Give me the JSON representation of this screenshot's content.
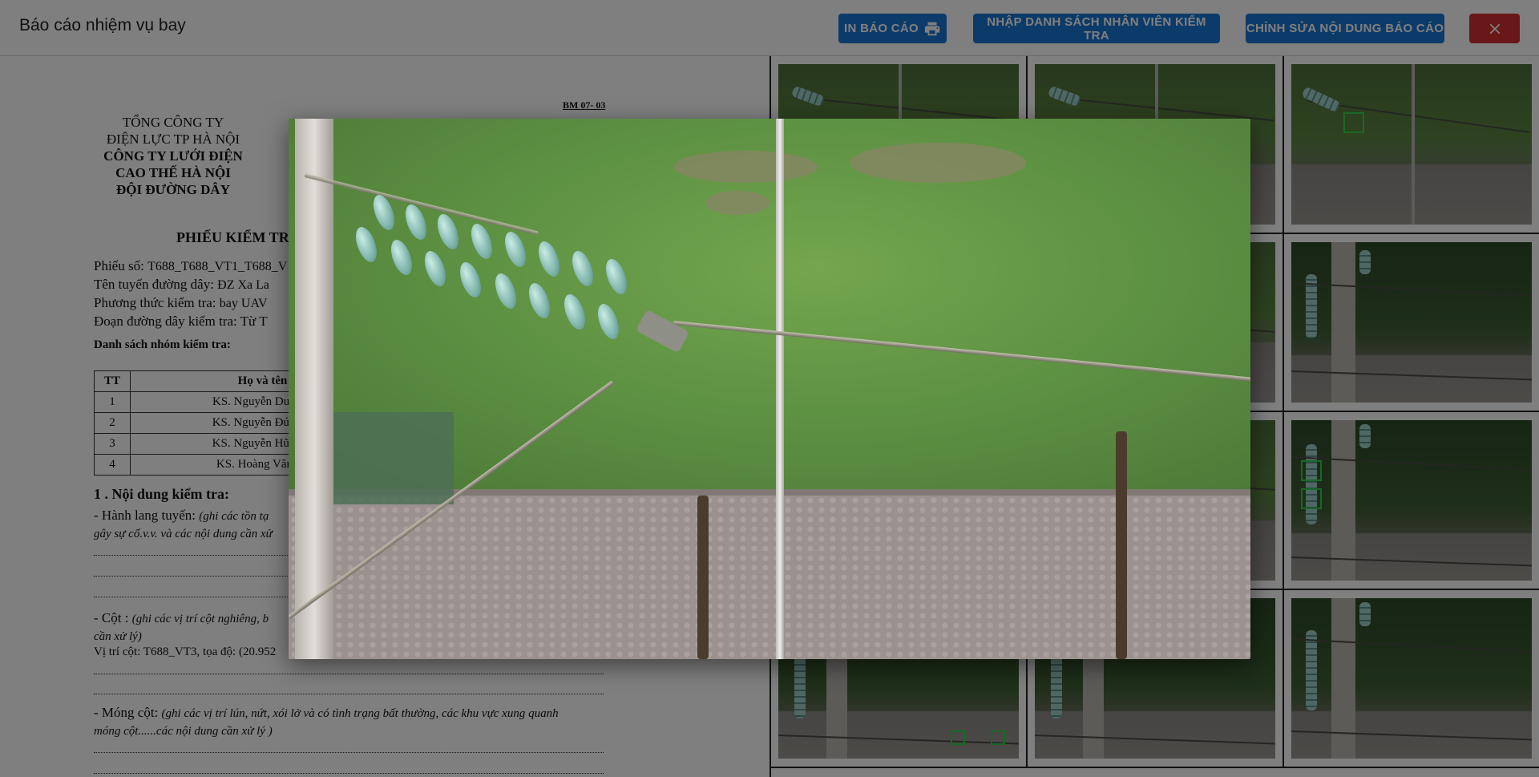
{
  "header": {
    "title": "Báo cáo nhiệm vụ bay",
    "print_label": "IN BÁO CÁO",
    "import_label": "NHẬP DANH SÁCH NHÂN VIÊN KIỂM TRA",
    "edit_label": "CHỈNH SỬA NỘI DUNG BÁO CÁO",
    "close_icon": "close-icon",
    "print_icon": "printer-icon"
  },
  "document": {
    "form_code": "BM 07- 03",
    "org": {
      "line1": "TỔNG CÔNG TY",
      "line2": "ĐIỆN LỰC TP HÀ NỘI",
      "line3": "CÔNG TY LƯỚI ĐIỆN",
      "line4": "CAO THẾ HÀ NỘI",
      "line5": "ĐỘI ĐƯỜNG DÂY"
    },
    "title": "PHIẾU KIỂM TR",
    "ticket_label": "Phiếu số:",
    "ticket_value": "T688_T688_VT1_T688_V",
    "route_label": "Tên tuyến đường dây:",
    "route_value": "ĐZ Xa La",
    "method_label": "Phương thức kiểm tra:",
    "method_value": "bay UAV",
    "segment_label": "Đoạn đường dây kiểm tra:",
    "segment_value": "Từ T",
    "group_label": "Danh sách nhóm kiểm tra:",
    "table": {
      "headers": [
        "TT",
        "Họ và tên"
      ],
      "rows": [
        [
          "1",
          "KS. Nguyễn Duy An"
        ],
        [
          "2",
          "KS. Nguyễn Đức Hù"
        ],
        [
          "3",
          "KS. Nguyễn Hữu Mi"
        ],
        [
          "4",
          "KS. Hoàng Văn Sơ"
        ]
      ]
    },
    "section1": "1 . Nội dung kiểm tra:",
    "corridor_label": "- Hành lang tuyến:",
    "corridor_note": "(ghi các tồn tạ",
    "corridor_note2": "gây sự cố.v.v. và các nội dung cần xử",
    "pole_label": "- Cột :",
    "pole_note": "(ghi các vị trí cột nghiêng, b",
    "pole_note2": "cần xử lý)",
    "pole_position": "Vị trí cột: T688_VT3, tọa độ: (20.952",
    "foundation_label": "- Móng cột:",
    "foundation_note": "(ghi các vị trí lún, nứt, xói lở và có tình trạng bất thường, các khu vực xung quanh",
    "foundation_note2": "móng cột......các nội dung cần xử lý )"
  },
  "gallery": {
    "images": [
      {
        "subject": "insulator-string-line"
      },
      {
        "subject": "insulator-string-line"
      },
      {
        "subject": "insulator-string-line-detected"
      },
      {
        "subject": "insulator-string-line"
      },
      {
        "subject": "insulator-string-line"
      },
      {
        "subject": "pole-insulators"
      },
      {
        "subject": "insulator-string-line"
      },
      {
        "subject": "insulator-string-line"
      },
      {
        "subject": "pole-insulators-detected"
      },
      {
        "subject": "pole-insulators"
      },
      {
        "subject": "pole-insulators"
      },
      {
        "subject": "pole-insulators"
      }
    ]
  },
  "colors": {
    "primary": "#1976d2",
    "danger": "#d32f2f",
    "overlay": "rgba(0,0,0,0.5)",
    "detection_box": "#33d04a"
  }
}
